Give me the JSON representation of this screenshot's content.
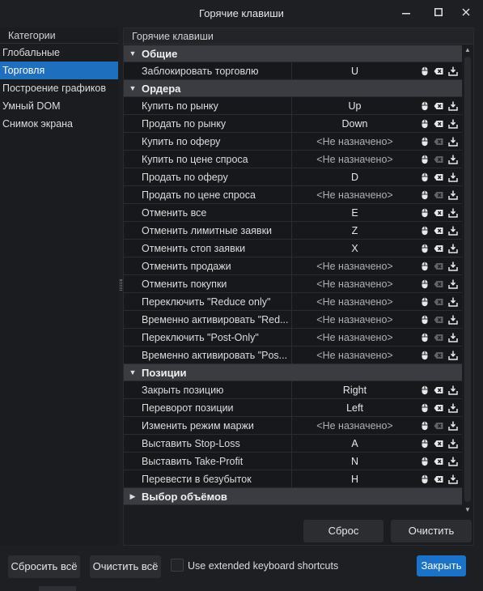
{
  "window": {
    "title": "Горячие клавиши",
    "minimize": "—",
    "maximize": "☐",
    "close": "✕"
  },
  "categories": {
    "header": "Категории",
    "items": [
      {
        "label": "Глобальные",
        "active": false
      },
      {
        "label": "Торговля",
        "active": true
      },
      {
        "label": "Построение графиков",
        "active": false
      },
      {
        "label": "Умный DOM",
        "active": false
      },
      {
        "label": "Снимок экрана",
        "active": false
      }
    ]
  },
  "hotkeys": {
    "header": "Горячие клавиши",
    "unset_text": "<Не назначено>",
    "groups": [
      {
        "title": "Общие",
        "expanded": true,
        "rows": [
          {
            "name": "Заблокировать торговлю",
            "key": "U",
            "assigned": true
          }
        ]
      },
      {
        "title": "Ордера",
        "expanded": true,
        "rows": [
          {
            "name": "Купить по рынку",
            "key": "Up",
            "assigned": true
          },
          {
            "name": "Продать по рынку",
            "key": "Down",
            "assigned": true
          },
          {
            "name": "Купить по оферу",
            "key": "<Не назначено>",
            "assigned": false
          },
          {
            "name": "Купить по цене спроса",
            "key": "<Не назначено>",
            "assigned": false
          },
          {
            "name": "Продать по оферу",
            "key": "D",
            "assigned": true
          },
          {
            "name": "Продать по цене спроса",
            "key": "<Не назначено>",
            "assigned": false
          },
          {
            "name": "Отменить все",
            "key": "E",
            "assigned": true
          },
          {
            "name": "Отменить лимитные заявки",
            "key": "Z",
            "assigned": true
          },
          {
            "name": "Отменить стоп заявки",
            "key": "X",
            "assigned": true
          },
          {
            "name": "Отменить продажи",
            "key": "<Не назначено>",
            "assigned": false
          },
          {
            "name": "Отменить покупки",
            "key": "<Не назначено>",
            "assigned": false
          },
          {
            "name": "Переключить \"Reduce only\"",
            "key": "<Не назначено>",
            "assigned": false
          },
          {
            "name": "Временно активировать \"Red...",
            "key": "<Не назначено>",
            "assigned": false
          },
          {
            "name": "Переключить \"Post-Only\"",
            "key": "<Не назначено>",
            "assigned": false
          },
          {
            "name": "Временно активировать \"Pos...",
            "key": "<Не назначено>",
            "assigned": false
          }
        ]
      },
      {
        "title": "Позиции",
        "expanded": true,
        "rows": [
          {
            "name": "Закрыть позицию",
            "key": "Right",
            "assigned": true
          },
          {
            "name": "Переворот позиции",
            "key": "Left",
            "assigned": true
          },
          {
            "name": "Изменить режим маржи",
            "key": "<Не назначено>",
            "assigned": false
          },
          {
            "name": "Выставить Stop-Loss",
            "key": "A",
            "assigned": true
          },
          {
            "name": "Выставить Take-Profit",
            "key": "N",
            "assigned": true
          },
          {
            "name": "Перевести в безубыток",
            "key": "H",
            "assigned": true
          }
        ]
      },
      {
        "title": "Выбор объёмов",
        "expanded": false,
        "rows": []
      }
    ]
  },
  "panel_buttons": {
    "reset": "Сброс",
    "clear": "Очистить"
  },
  "footer": {
    "reset_all": "Сбросить всё",
    "clear_all": "Очистить всё",
    "extended_label": "Use extended keyboard shortcuts",
    "extended_checked": false,
    "close": "Закрыть"
  },
  "icons": {
    "mouse": "mouse-icon",
    "clear": "clear-key-icon",
    "record": "record-key-icon"
  }
}
